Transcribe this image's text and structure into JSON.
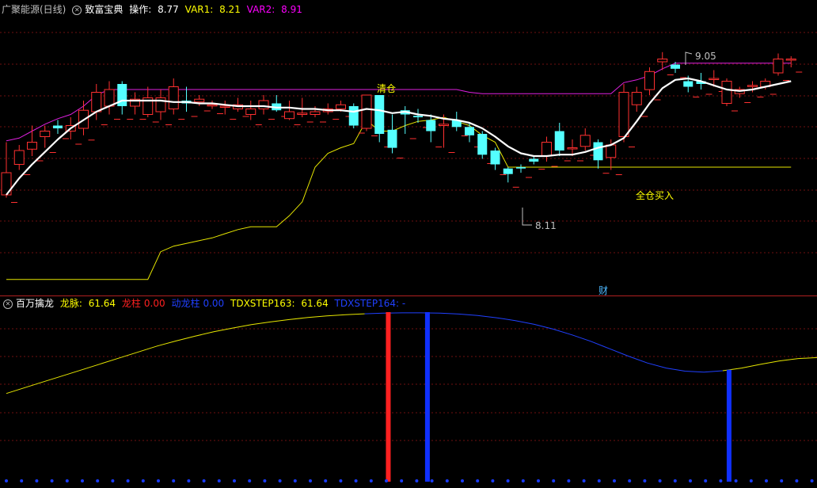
{
  "header_main": {
    "symbol": "广聚能源(日线)",
    "indicator": "致富宝典",
    "op_label": "操作: ",
    "op_value": "8.77",
    "var1_label": "VAR1: ",
    "var1_value": "8.21",
    "var2_label": "VAR2: ",
    "var2_value": "8.91",
    "colors": {
      "symbol": "#c0c0c0",
      "indicator": "#ffffff",
      "op": "#ffffff",
      "var1": "#ffff00",
      "var2": "#ff00ff"
    }
  },
  "header_sub": {
    "indicator": "百万擒龙",
    "longmai_label": "龙脉: ",
    "longmai_value": "61.64",
    "longzhu_label": "龙柱",
    "longzhu_value": "0.00",
    "qianlong_label": "动龙柱",
    "qianlong_value": "0.00",
    "step163_label": "TDXSTEP163: ",
    "step163_value": "61.64",
    "step164_label": "TDXSTEP164: -",
    "colors": {
      "longmai": "#ffff00",
      "longzhu": "#ff2020",
      "qianlong": "#2040ff",
      "step163": "#ffff00",
      "step164": "#2040ff"
    }
  },
  "annotations": {
    "qingcang": "清仓",
    "quancang": "全仓买入",
    "high_mark": "9.05",
    "low_mark": "8.11",
    "cai": "财"
  },
  "chart_data": {
    "type": "candlestick",
    "price_ylim": [
      7.3,
      9.3
    ],
    "candles": [
      [
        8.02,
        8.18,
        8.4,
        8.0
      ],
      [
        8.24,
        8.34,
        8.38,
        8.2
      ],
      [
        8.35,
        8.4,
        8.52,
        8.3
      ],
      [
        8.44,
        8.48,
        8.52,
        8.36
      ],
      [
        8.52,
        8.5,
        8.56,
        8.46
      ],
      [
        8.48,
        8.52,
        8.58,
        8.42
      ],
      [
        8.5,
        8.63,
        8.7,
        8.45
      ],
      [
        8.62,
        8.76,
        8.82,
        8.56
      ],
      [
        8.66,
        8.78,
        8.84,
        8.6
      ],
      [
        8.82,
        8.66,
        8.84,
        8.6
      ],
      [
        8.66,
        8.71,
        8.76,
        8.6
      ],
      [
        8.6,
        8.72,
        8.8,
        8.58
      ],
      [
        8.62,
        8.72,
        8.78,
        8.56
      ],
      [
        8.64,
        8.8,
        8.86,
        8.6
      ],
      [
        8.7,
        8.68,
        8.8,
        8.62
      ],
      [
        8.69,
        8.71,
        8.74,
        8.66
      ],
      [
        8.67,
        8.67,
        8.7,
        8.64
      ],
      [
        8.66,
        8.66,
        8.7,
        8.6
      ],
      [
        8.64,
        8.67,
        8.72,
        8.62
      ],
      [
        8.6,
        8.64,
        8.7,
        8.56
      ],
      [
        8.64,
        8.7,
        8.74,
        8.6
      ],
      [
        8.68,
        8.63,
        8.74,
        8.62
      ],
      [
        8.57,
        8.62,
        8.7,
        8.56
      ],
      [
        8.6,
        8.61,
        8.72,
        8.58
      ],
      [
        8.6,
        8.62,
        8.66,
        8.58
      ],
      [
        8.62,
        8.64,
        8.68,
        8.6
      ],
      [
        8.64,
        8.67,
        8.7,
        8.62
      ],
      [
        8.66,
        8.52,
        8.68,
        8.5
      ],
      [
        8.5,
        8.74,
        8.74,
        8.48
      ],
      [
        8.74,
        8.46,
        8.74,
        8.4
      ],
      [
        8.49,
        8.36,
        8.6,
        8.32
      ],
      [
        8.63,
        8.6,
        8.66,
        8.46
      ],
      [
        8.59,
        8.58,
        8.64,
        8.54
      ],
      [
        8.56,
        8.48,
        8.6,
        8.4
      ],
      [
        8.52,
        8.53,
        8.6,
        8.36
      ],
      [
        8.56,
        8.51,
        8.62,
        8.48
      ],
      [
        8.51,
        8.45,
        8.54,
        8.4
      ],
      [
        8.46,
        8.31,
        8.48,
        8.28
      ],
      [
        8.34,
        8.24,
        8.36,
        8.2
      ],
      [
        8.21,
        8.17,
        8.22,
        8.11
      ],
      [
        8.22,
        8.21,
        8.24,
        8.18
      ],
      [
        8.28,
        8.26,
        8.3,
        8.24
      ],
      [
        8.3,
        8.4,
        8.44,
        8.26
      ],
      [
        8.48,
        8.34,
        8.54,
        8.3
      ],
      [
        8.36,
        8.36,
        8.42,
        8.3
      ],
      [
        8.37,
        8.45,
        8.5,
        8.34
      ],
      [
        8.4,
        8.27,
        8.42,
        8.21
      ],
      [
        8.29,
        8.38,
        8.42,
        8.2
      ],
      [
        8.44,
        8.76,
        8.82,
        8.4
      ],
      [
        8.67,
        8.76,
        8.8,
        8.62
      ],
      [
        8.78,
        8.91,
        8.94,
        8.74
      ],
      [
        8.98,
        9.0,
        9.05,
        8.92
      ],
      [
        8.96,
        8.93,
        8.98,
        8.9
      ],
      [
        8.84,
        8.8,
        8.88,
        8.76
      ],
      [
        8.84,
        8.82,
        8.9,
        8.78
      ],
      [
        8.86,
        8.86,
        8.92,
        8.8
      ],
      [
        8.68,
        8.84,
        8.86,
        8.66
      ],
      [
        8.75,
        8.78,
        8.8,
        8.72
      ],
      [
        8.81,
        8.81,
        8.84,
        8.76
      ],
      [
        8.8,
        8.84,
        8.86,
        8.78
      ],
      [
        8.9,
        9.0,
        9.04,
        8.88
      ],
      [
        9.0,
        9.0,
        9.02,
        8.94
      ]
    ],
    "ma_white": [
      8.02,
      8.14,
      8.24,
      8.33,
      8.42,
      8.5,
      8.56,
      8.62,
      8.66,
      8.7,
      8.7,
      8.7,
      8.7,
      8.69,
      8.69,
      8.68,
      8.68,
      8.67,
      8.66,
      8.66,
      8.66,
      8.65,
      8.65,
      8.64,
      8.64,
      8.63,
      8.63,
      8.62,
      8.64,
      8.63,
      8.61,
      8.62,
      8.6,
      8.59,
      8.57,
      8.56,
      8.54,
      8.5,
      8.44,
      8.37,
      8.32,
      8.3,
      8.3,
      8.31,
      8.31,
      8.33,
      8.36,
      8.38,
      8.43,
      8.55,
      8.68,
      8.79,
      8.85,
      8.86,
      8.84,
      8.81,
      8.78,
      8.77,
      8.78,
      8.8,
      8.82,
      8.84
    ],
    "var2_magenta": [
      8.41,
      8.43,
      8.48,
      8.53,
      8.57,
      8.6,
      8.66,
      8.74,
      8.78,
      8.78,
      8.78,
      8.78,
      8.78,
      8.78,
      8.78,
      8.78,
      8.78,
      8.78,
      8.78,
      8.78,
      8.78,
      8.78,
      8.78,
      8.78,
      8.78,
      8.78,
      8.78,
      8.78,
      8.78,
      8.78,
      8.78,
      8.78,
      8.78,
      8.78,
      8.78,
      8.78,
      8.76,
      8.75,
      8.75,
      8.75,
      8.75,
      8.75,
      8.75,
      8.75,
      8.75,
      8.75,
      8.75,
      8.75,
      8.83,
      8.85,
      8.88,
      8.93,
      8.97,
      8.97,
      8.97,
      8.97,
      8.97,
      8.97,
      8.97,
      8.97,
      8.97,
      8.97
    ],
    "var1_yellow": [
      7.41,
      7.41,
      7.41,
      7.41,
      7.41,
      7.41,
      7.41,
      7.41,
      7.41,
      7.41,
      7.41,
      7.41,
      7.61,
      7.65,
      7.67,
      7.69,
      7.71,
      7.74,
      7.77,
      7.79,
      7.79,
      7.79,
      7.87,
      7.97,
      8.22,
      8.32,
      8.36,
      8.39,
      8.56,
      8.48,
      8.48,
      8.52,
      8.55,
      8.56,
      8.58,
      8.55,
      8.52,
      8.45,
      8.4,
      8.22,
      8.22,
      8.22,
      8.22,
      8.22,
      8.22,
      8.22,
      8.22,
      8.22,
      8.22,
      8.22,
      8.22,
      8.22,
      8.22,
      8.22,
      8.22,
      8.22,
      8.22,
      8.22,
      8.22,
      8.22,
      8.22,
      8.22
    ],
    "sub_ylim": [
      0,
      100
    ],
    "longmai": [
      52,
      55.5,
      59,
      62.5,
      66,
      69.5,
      73,
      76.5,
      80,
      83,
      85.8,
      88.4,
      90.6,
      92.6,
      94.2,
      95.6,
      96.8,
      97.8,
      98.5,
      99,
      99.4,
      99.6,
      99.6,
      99.4,
      98.9,
      98,
      96.7,
      95,
      92.8,
      90,
      86.6,
      82.8,
      78.4,
      74,
      70,
      67,
      65.2,
      64.6,
      65.4,
      67,
      69.2,
      71.2,
      72.6,
      73.2
    ],
    "longzhu_bars": [
      {
        "index": 19,
        "value": 100
      }
    ],
    "qianlong_bars": [
      {
        "index": 22,
        "value": 100
      },
      {
        "index": 38,
        "value": 66
      }
    ]
  }
}
